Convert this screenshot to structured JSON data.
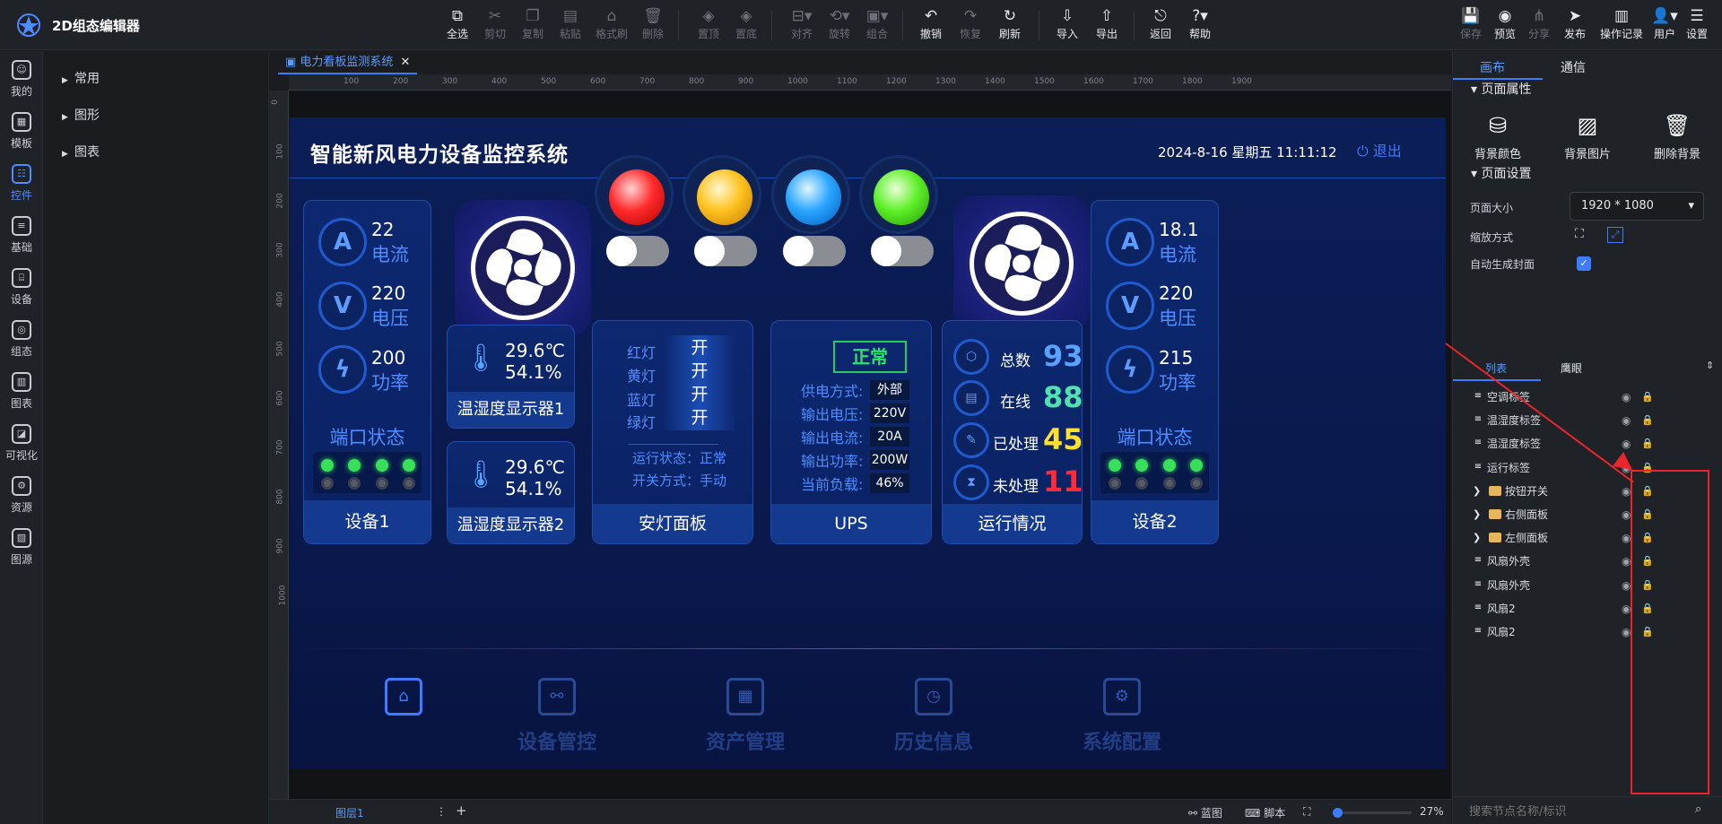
{
  "app": {
    "title": "2D组态编辑器"
  },
  "toolbar": {
    "select_all": "全选",
    "cut": "剪切",
    "copy": "复制",
    "paste": "粘贴",
    "format_brush": "格式刷",
    "delete": "删除",
    "top": "置顶",
    "bottom": "置底",
    "align": "对齐",
    "rotate": "旋转",
    "group": "组合",
    "undo": "撤销",
    "redo": "恢复",
    "refresh": "刷新",
    "import": "导入",
    "export": "导出",
    "back": "返回",
    "help": "帮助",
    "save": "保存",
    "preview": "预览",
    "share": "分享",
    "publish": "发布",
    "oplog": "操作记录",
    "user": "用户",
    "settings": "设置"
  },
  "left_nav": [
    "我的",
    "模板",
    "控件",
    "基础",
    "设备",
    "组态",
    "图表",
    "可视化",
    "资源",
    "图源"
  ],
  "tree": [
    "常用",
    "图形",
    "图表"
  ],
  "document_tab": "电力看板监测系统",
  "ruler_h": [
    "100",
    "200",
    "300",
    "400",
    "500",
    "600",
    "700",
    "800",
    "900",
    "1000",
    "1100",
    "1200",
    "1300",
    "1400",
    "1500",
    "1600",
    "1700",
    "1800",
    "1900"
  ],
  "ruler_v": [
    "0",
    "100",
    "200",
    "300",
    "400",
    "500",
    "600",
    "700",
    "800",
    "900",
    "1000"
  ],
  "board": {
    "title": "智能新风电力设备监控系统",
    "datetime": "2024-8-16 星期五 11:11:12",
    "logout": "退出",
    "device1": {
      "current": "22",
      "current_lbl": "电流",
      "voltage": "220",
      "voltage_lbl": "电压",
      "power": "200",
      "power_lbl": "功率",
      "port_title": "端口状态",
      "footer": "设备1"
    },
    "device2": {
      "current": "18.1",
      "current_lbl": "电流",
      "voltage": "220",
      "voltage_lbl": "电压",
      "power": "215",
      "power_lbl": "功率",
      "port_title": "端口状态",
      "footer": "设备2"
    },
    "th1": {
      "temp": "29.6℃",
      "hum": "54.1%",
      "footer": "温湿度显示器1"
    },
    "th2": {
      "temp": "29.6℃",
      "hum": "54.1%",
      "footer": "温湿度显示器2"
    },
    "lamps": {
      "red_lbl": "红灯",
      "red_val": "开",
      "yellow_lbl": "黄灯",
      "yellow_val": "开",
      "blue_lbl": "蓝灯",
      "blue_val": "开",
      "green_lbl": "绿灯",
      "green_val": "开",
      "run_state": "运行状态：正常",
      "switch_mode": "开关方式：手动",
      "footer": "安灯面板"
    },
    "ups": {
      "status": "正常",
      "supply_lbl": "供电方式:",
      "supply": "外部",
      "voltage_lbl": "输出电压:",
      "voltage": "220V",
      "current_lbl": "输出电流:",
      "current": "20A",
      "power_lbl": "输出功率:",
      "power": "200W",
      "load_lbl": "当前负载:",
      "load": "46%",
      "footer": "UPS"
    },
    "stats": {
      "total_lbl": "总数",
      "total": "93",
      "online_lbl": "在线",
      "online": "88",
      "done_lbl": "已处理",
      "done": "45",
      "pending_lbl": "未处理",
      "pending": "11",
      "footer": "运行情况"
    },
    "nav": [
      "设备管控",
      "资产管理",
      "历史信息",
      "系统配置"
    ]
  },
  "right_panel": {
    "tab_canvas": "画布",
    "tab_comm": "通信",
    "page_props": "页面属性",
    "bg_color": "背景颜色",
    "bg_image": "背景图片",
    "bg_delete": "删除背景",
    "page_settings": "页面设置",
    "page_size_lbl": "页面大小",
    "page_size": "1920 * 1080",
    "scale_lbl": "缩放方式",
    "auto_cover_lbl": "自动生成封面",
    "tab_list": "列表",
    "tab_eagle": "鹰眼",
    "layers": [
      {
        "name": "空调标签",
        "folder": false
      },
      {
        "name": "温湿度标签",
        "folder": false
      },
      {
        "name": "温湿度标签",
        "folder": false
      },
      {
        "name": "运行标签",
        "folder": false
      },
      {
        "name": "按钮开关",
        "folder": true
      },
      {
        "name": "右侧面板",
        "folder": true
      },
      {
        "name": "左侧面板",
        "folder": true
      },
      {
        "name": "风扇外壳",
        "folder": false
      },
      {
        "name": "风扇外壳",
        "folder": false
      },
      {
        "name": "风扇2",
        "folder": false
      },
      {
        "name": "风扇2",
        "folder": false
      }
    ],
    "search_placeholder": "搜索节点名称/标识"
  },
  "bottom": {
    "layer": "图层1",
    "blueprint": "蓝图",
    "script": "脚本",
    "zoom": "27%",
    "zoom_level": 0.27
  },
  "colors": {
    "accent": "#3d7bff",
    "board_bg": "#0b1e57",
    "stat_total": "#5aa2ff",
    "stat_online": "#4fe3b0",
    "stat_done": "#ffe02e",
    "stat_pending": "#ff2a3a",
    "annotation": "#e8262b"
  }
}
